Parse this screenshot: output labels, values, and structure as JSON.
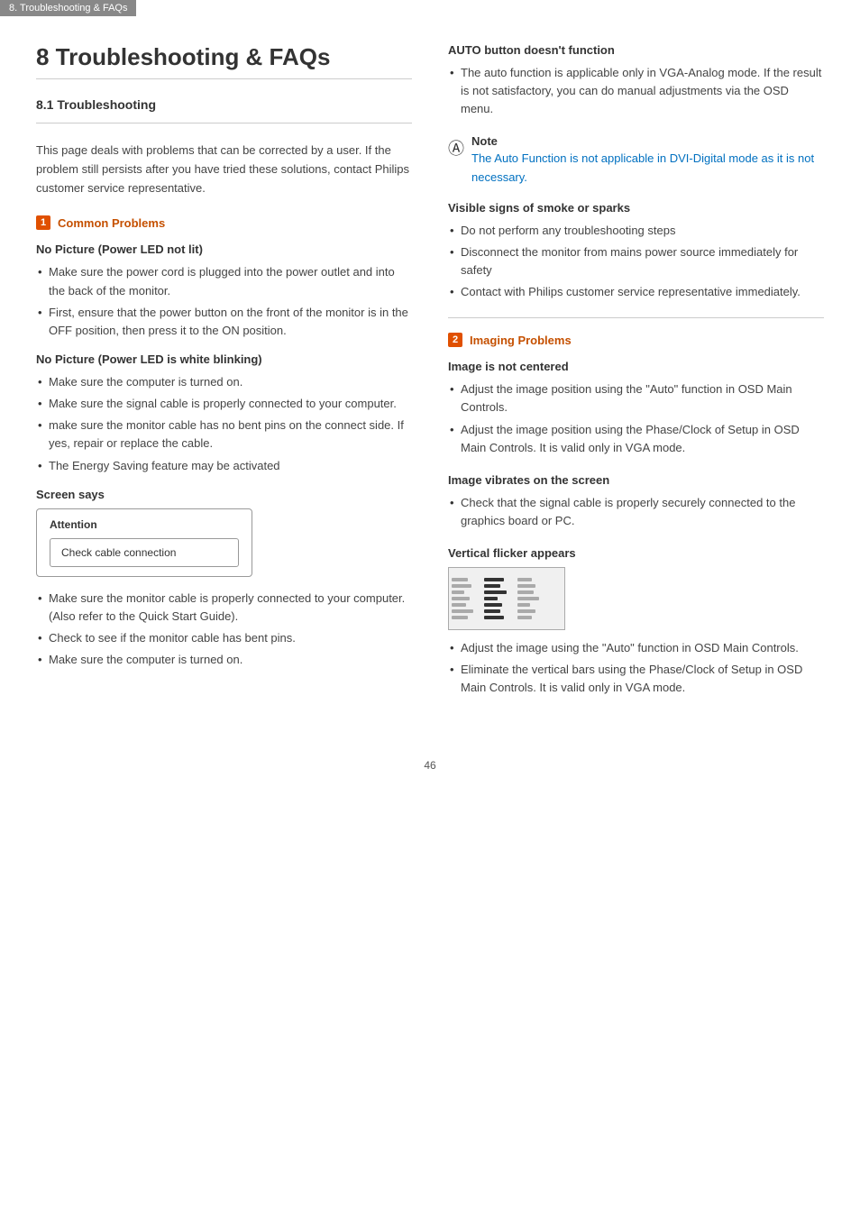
{
  "tab": "8. Troubleshooting & FAQs",
  "page_title": "8  Troubleshooting & FAQs",
  "section_8_1": "8.1  Troubleshooting",
  "intro": "This page deals with problems that can be corrected by a user. If the problem still persists after you have tried these solutions, contact Philips customer service representative.",
  "common_problems_badge": "1",
  "common_problems_label": "Common Problems",
  "no_picture_led_not_lit": "No Picture (Power LED not lit)",
  "no_picture_led_bullets": [
    "Make sure the power cord is plugged into the power outlet and into the back of the monitor.",
    "First, ensure that the power button on the front of the monitor is in the OFF position, then press it to the ON position."
  ],
  "no_picture_led_blinking": "No Picture (Power LED is white blinking)",
  "no_picture_blinking_bullets": [
    "Make sure the computer is turned on.",
    "Make sure the signal cable is properly connected to your computer.",
    "make sure the monitor cable has no bent pins on the connect side. If yes, repair or replace the cable.",
    "The Energy Saving feature may be activated"
  ],
  "screen_says_label": "Screen says",
  "attention_title": "Attention",
  "check_cable_text": "Check cable connection",
  "screen_says_bullets": [
    "Make sure the monitor cable is properly connected to your computer. (Also refer to the Quick Start Guide).",
    "Check to see if the monitor cable has bent pins.",
    "Make sure the computer is turned on."
  ],
  "auto_button_title": "AUTO button doesn't function",
  "auto_button_bullets": [
    "The auto function is applicable only in VGA-Analog mode.  If the result is not satisfactory, you can do manual adjustments via the OSD menu."
  ],
  "note_label": "Note",
  "note_text": "The Auto Function is not applicable in DVI-Digital mode as it is not necessary.",
  "visible_signs_title": "Visible signs of smoke or sparks",
  "visible_signs_bullets": [
    "Do not perform any troubleshooting steps",
    "Disconnect the monitor from mains power source immediately for safety",
    "Contact with Philips customer service representative immediately."
  ],
  "imaging_problems_badge": "2",
  "imaging_problems_label": "Imaging Problems",
  "image_not_centered_title": "Image is not centered",
  "image_not_centered_bullets": [
    "Adjust the image position using the \"Auto\" function in OSD Main Controls.",
    "Adjust the image position using the Phase/Clock of Setup in OSD Main Controls.  It is valid only in VGA mode."
  ],
  "image_vibrates_title": "Image vibrates on the screen",
  "image_vibrates_bullets": [
    "Check that the signal cable is properly securely connected to the graphics board or PC."
  ],
  "vertical_flicker_title": "Vertical flicker appears",
  "vertical_flicker_bullets": [
    "Adjust the image using the \"Auto\" function in OSD Main Controls.",
    "Eliminate the vertical bars using the Phase/Clock of Setup in OSD Main Controls. It is valid only in VGA mode."
  ],
  "page_number": "46"
}
